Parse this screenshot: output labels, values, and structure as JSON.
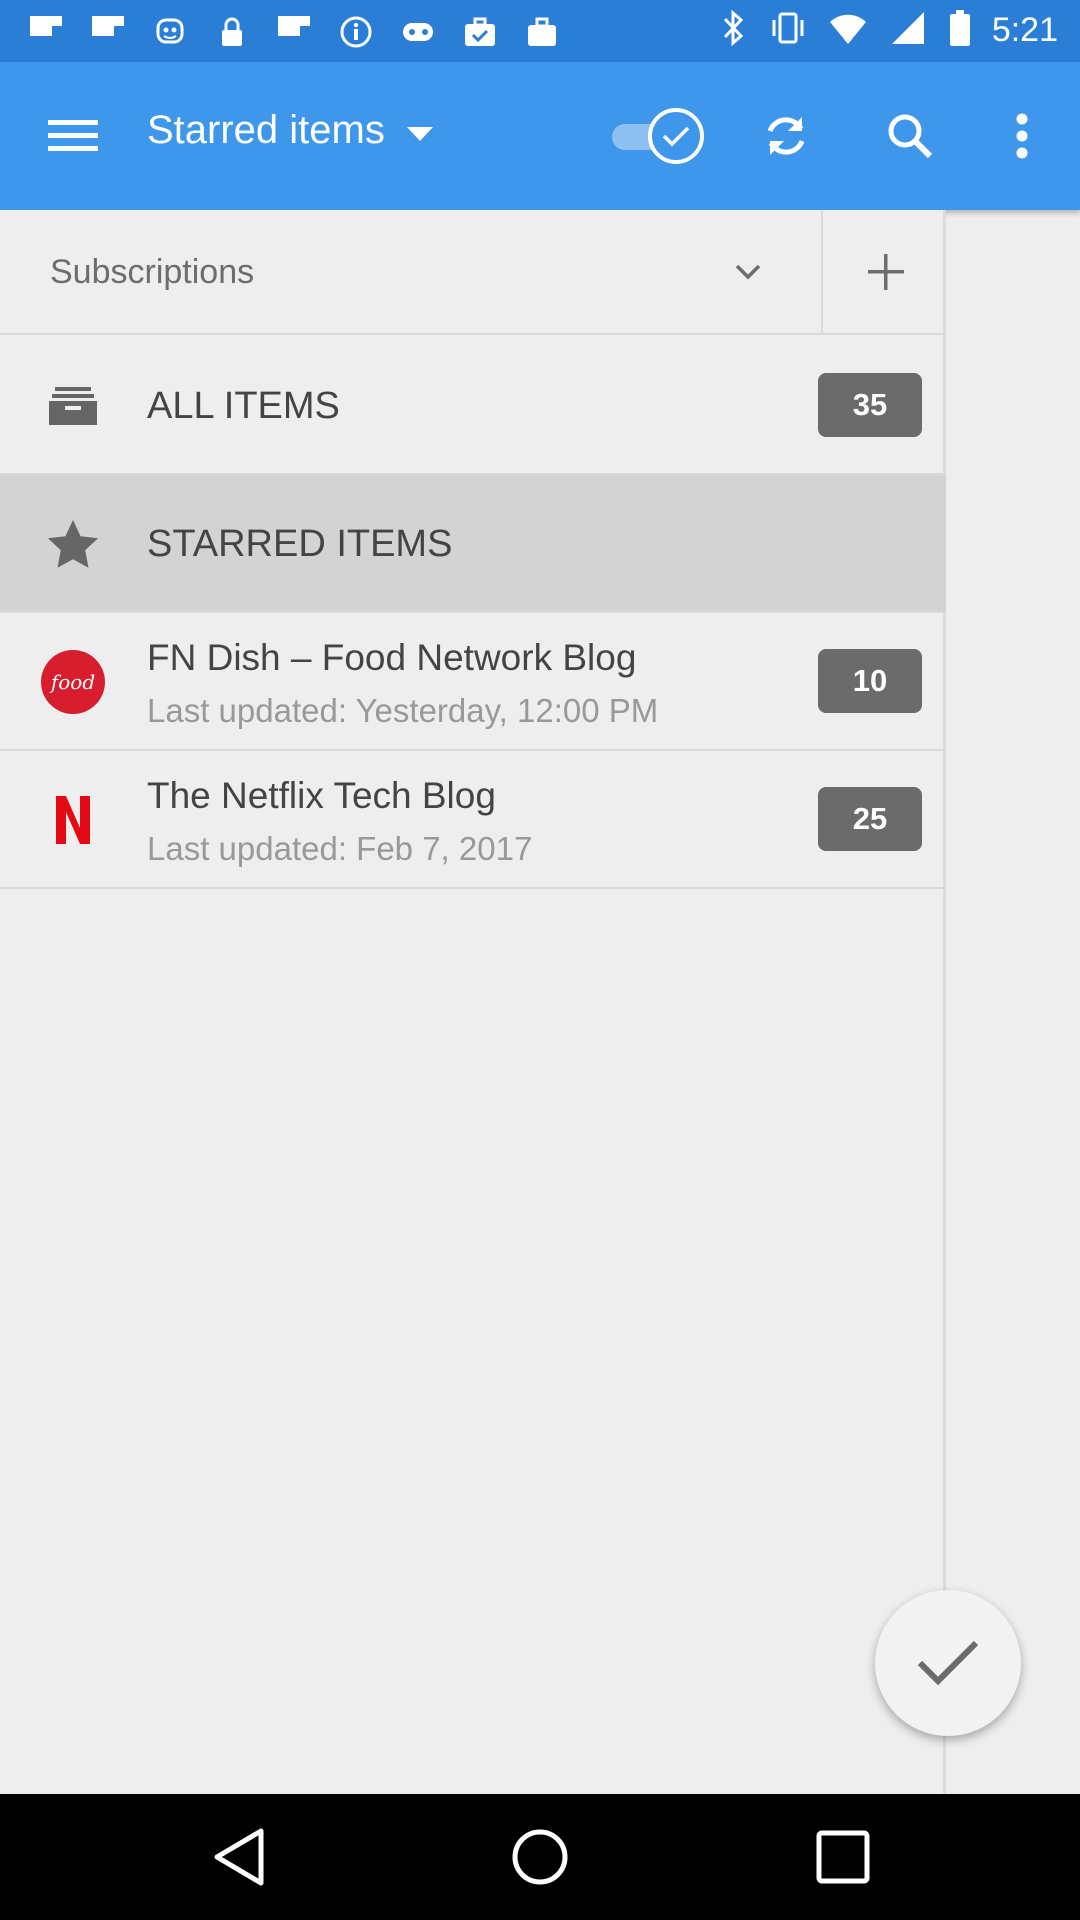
{
  "status_bar": {
    "time": "5:21",
    "left_icons": [
      "flipboard-icon",
      "flipboard-icon",
      "bot-icon",
      "lock-icon",
      "flipboard-icon",
      "info-icon",
      "game-icon",
      "briefcase-check-icon",
      "bag-icon"
    ],
    "right_icons": [
      "bluetooth-icon",
      "vibrate-icon",
      "wifi-icon",
      "signal-icon",
      "battery-icon"
    ]
  },
  "app_bar": {
    "title": "Starred items",
    "color": "#3e97ea",
    "icons": [
      "menu-icon",
      "caret-down-icon",
      "toggle-check-icon",
      "refresh-icon",
      "search-icon",
      "more-vert-icon"
    ]
  },
  "drawer": {
    "subscriptions_label": "Subscriptions",
    "rows": [
      {
        "title": "ALL ITEMS",
        "icon": "inbox-icon",
        "count": "35",
        "selected": false
      },
      {
        "title": "STARRED ITEMS",
        "icon": "star-icon",
        "count": "",
        "selected": true
      },
      {
        "title": "FN Dish – Food Network Blog",
        "subtitle": "Last updated: Yesterday, 12:00 PM",
        "icon": "food-network-icon",
        "count": "10"
      },
      {
        "title": "The Netflix Tech Blog",
        "subtitle": "Last updated: Feb 7, 2017",
        "icon": "netflix-icon",
        "count": "25"
      }
    ]
  },
  "fab": {
    "icon": "check-icon"
  },
  "nav_bar": {
    "icons": [
      "back-icon",
      "home-icon",
      "recents-icon"
    ]
  }
}
